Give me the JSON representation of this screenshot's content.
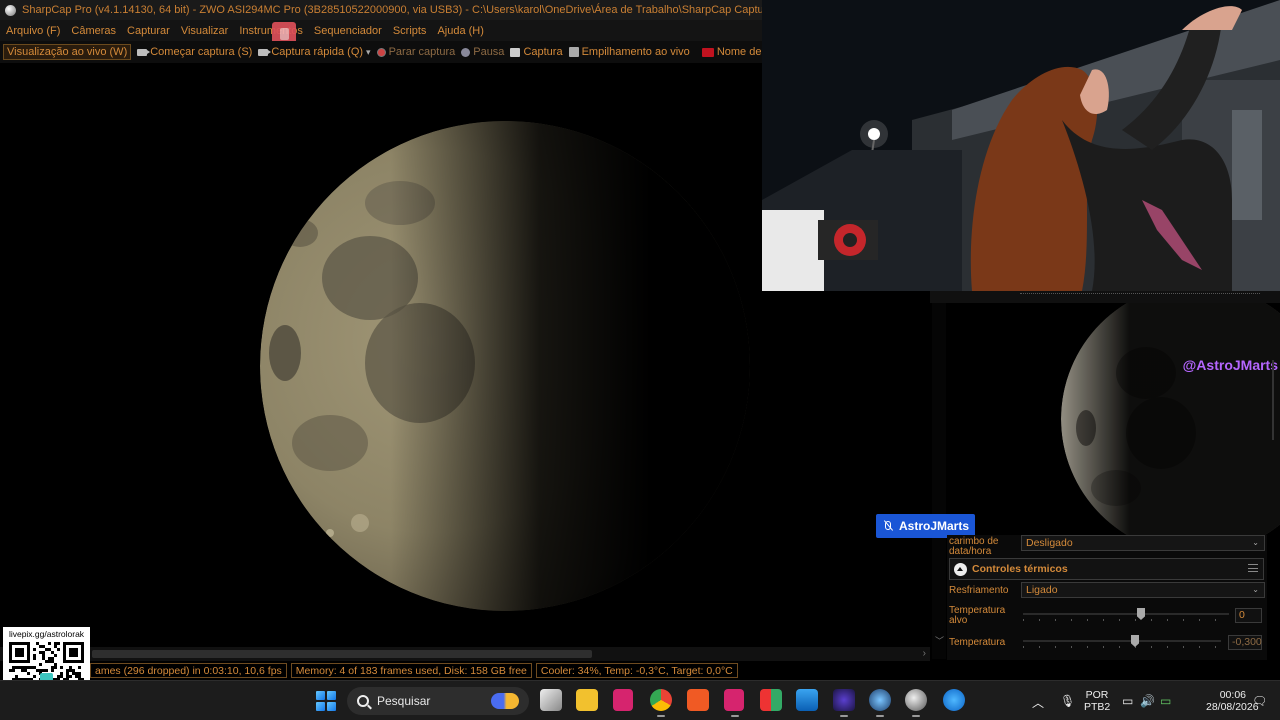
{
  "window": {
    "title": "SharpCap Pro (v4.1.14130, 64 bit) - ZWO ASI294MC Pro (3B28510522000900, via USB3) - C:\\Users\\karol\\OneDrive\\Área de Trabalho\\SharpCap Captures"
  },
  "menu": {
    "items": [
      "Arquivo (F)",
      "Câmeras",
      "Capturar",
      "Visualizar",
      "Instrumentos",
      "Sequenciador",
      "Scripts",
      "Ajuda (H)"
    ]
  },
  "toolbar": {
    "live_view": "Visualização ao vivo (W)",
    "start_capture": "Começar captura (S)",
    "quick_capture": "Captura rápida (Q)",
    "stop_capture": "Parar captura",
    "pause": "Pausa",
    "snapshot": "Captura",
    "live_stack": "Empilhamento ao vivo",
    "target_name": "Nome de destino"
  },
  "status": {
    "frames": "ames (296 dropped) in 0:03:10, 10,6 fps",
    "memory": "Memory: 4 of 183 frames used, Disk: 158 GB free",
    "cooler": "Cooler: 34%, Temp: -0,3°C, Target: 0,0°C"
  },
  "overlay": {
    "handle": "@AstroJMarts",
    "badge_name": "AstroJMarts",
    "qr_text": "livepix.gg/astrolorak"
  },
  "controls": {
    "timestamp_label": "carimbo de data/hora",
    "timestamp_value": "Desligado",
    "thermal_section": "Controles térmicos",
    "cooling_label": "Resfriamento",
    "cooling_value": "Ligado",
    "target_temp_label": "Temperatura alvo",
    "target_temp_value": "0",
    "temperature_label": "Temperatura",
    "temperature_value": "-0,300"
  },
  "taskbar": {
    "search_placeholder": "Pesquisar",
    "lang_top": "POR",
    "lang_bottom": "PTB2",
    "time": "00:06",
    "date": "28/08/2026"
  },
  "colors": {
    "accent_text": "#d48a3a",
    "handle_purple": "#b566ff",
    "badge_blue": "#1a56d6"
  }
}
